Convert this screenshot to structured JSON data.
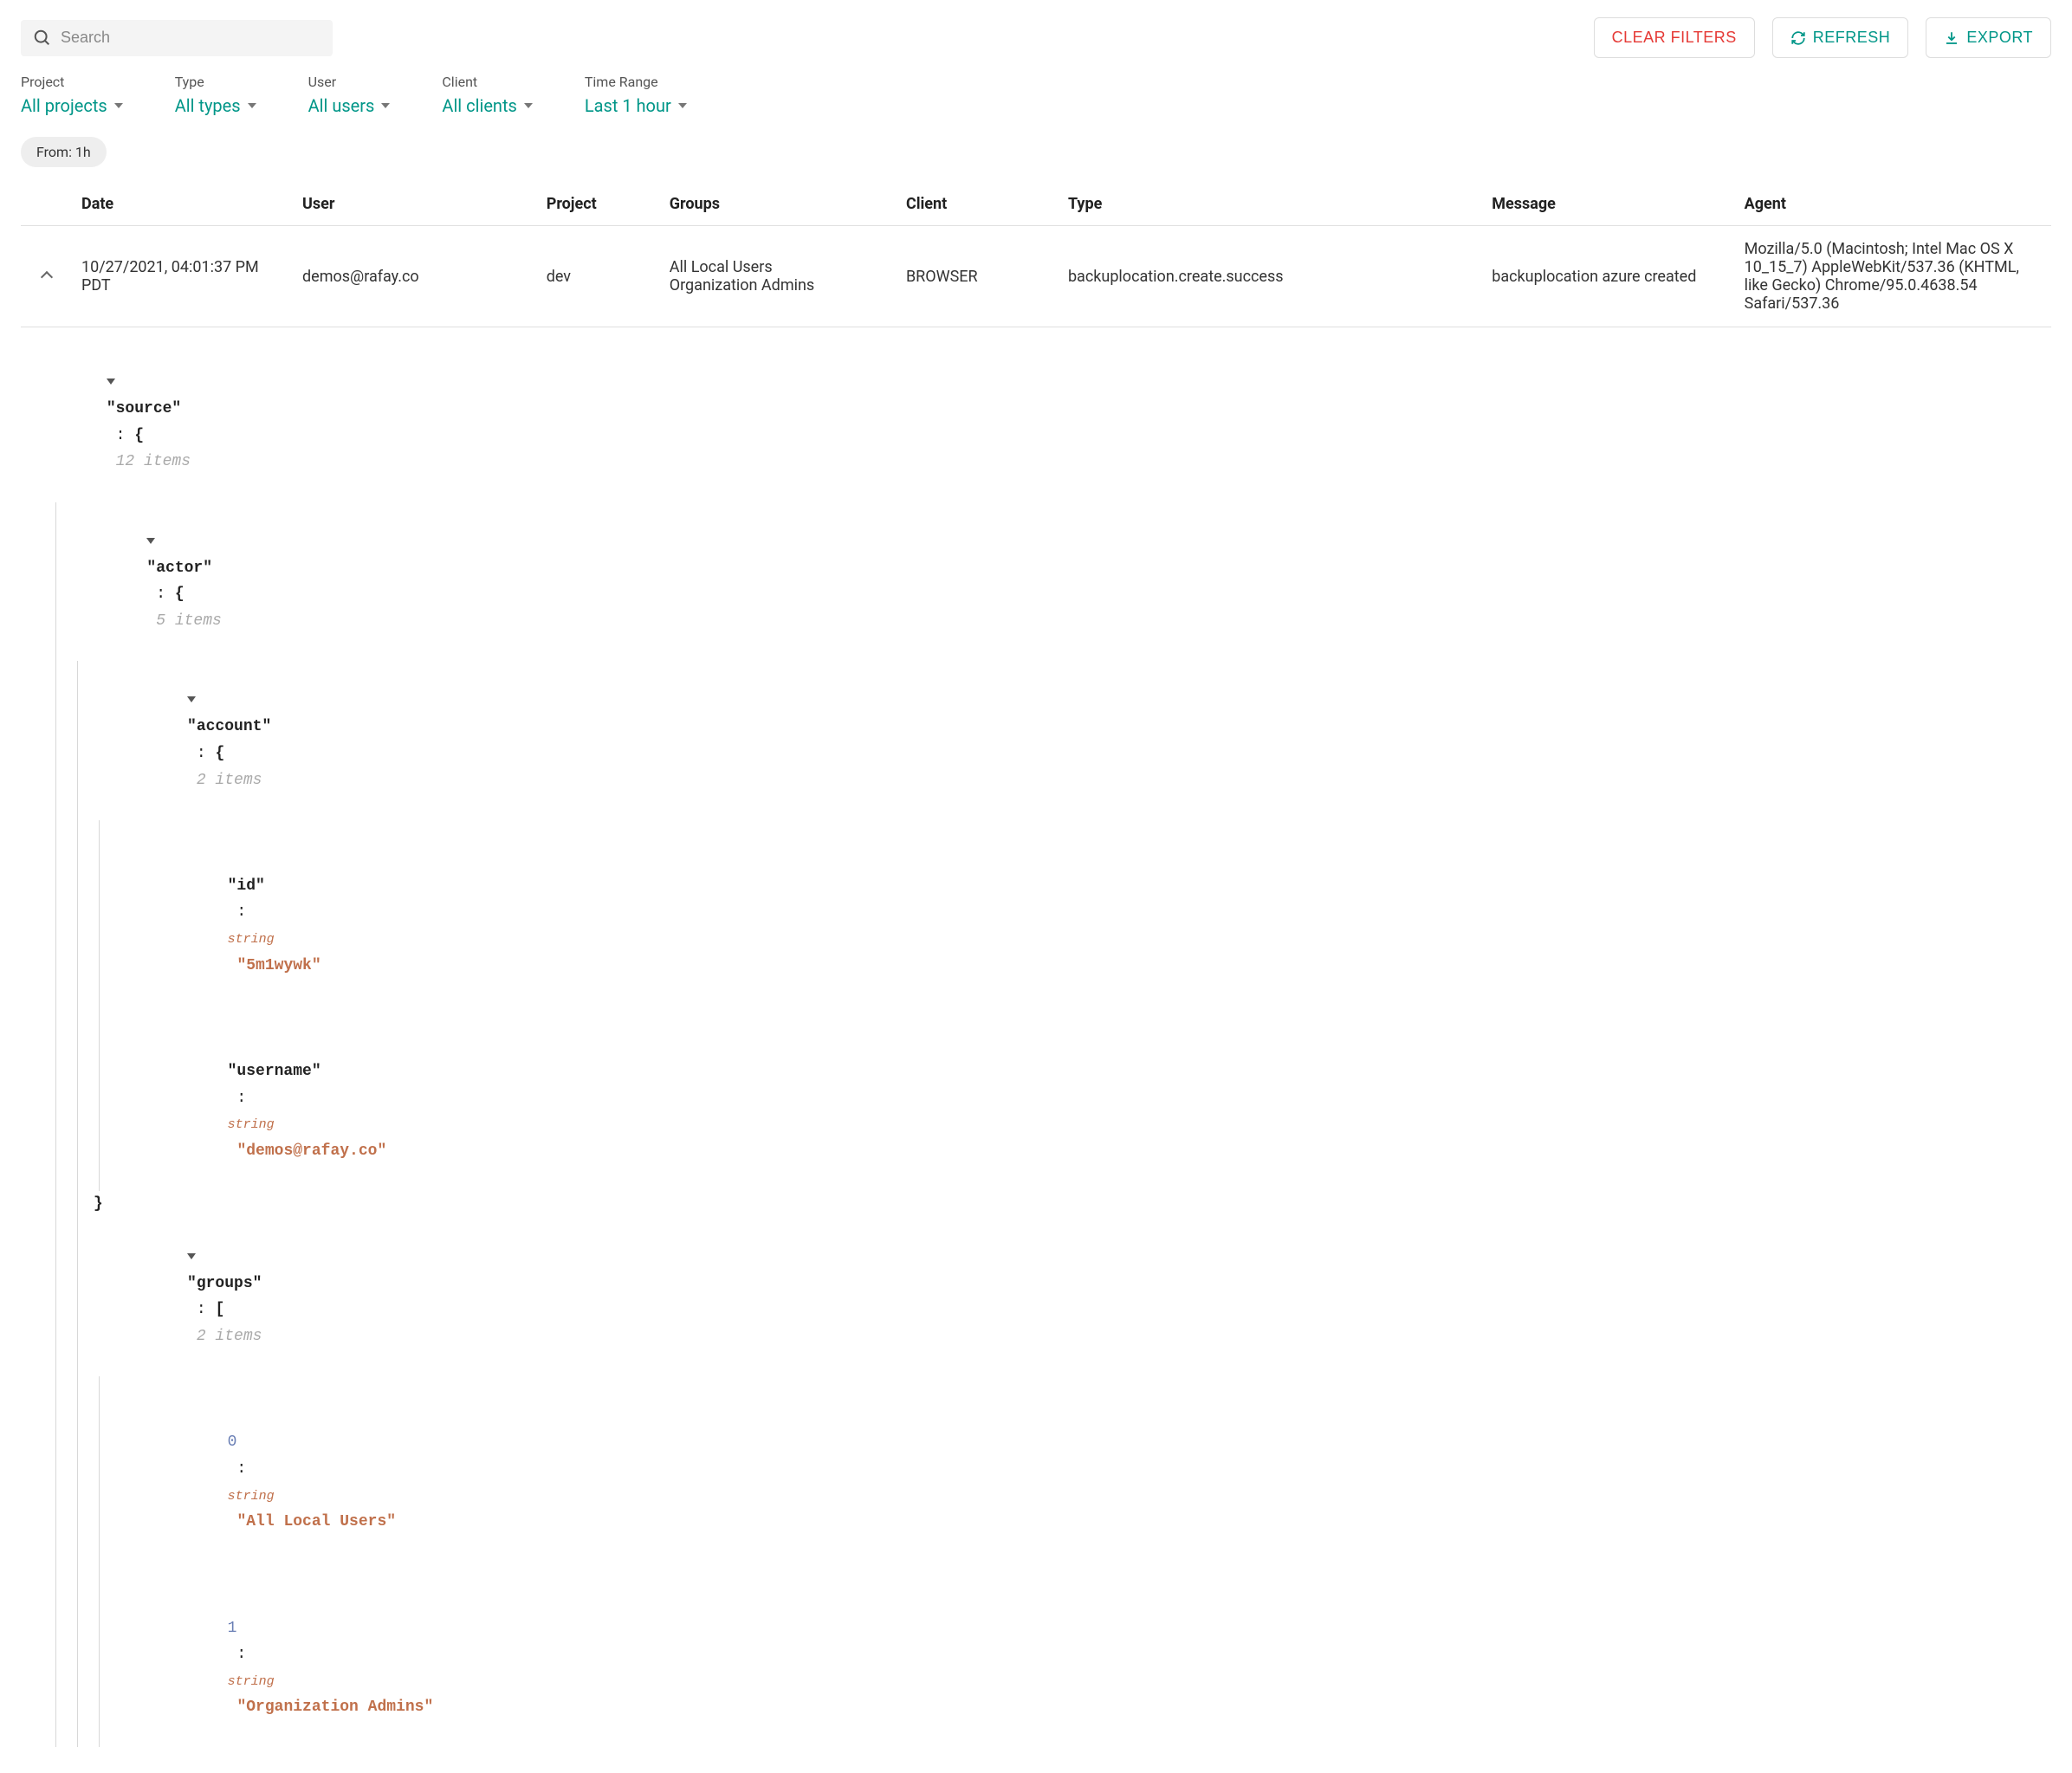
{
  "search": {
    "placeholder": "Search"
  },
  "actions": {
    "clear_filters": "CLEAR FILTERS",
    "refresh": "REFRESH",
    "export": "EXPORT"
  },
  "filters": {
    "project": {
      "label": "Project",
      "value": "All projects"
    },
    "type": {
      "label": "Type",
      "value": "All types"
    },
    "user": {
      "label": "User",
      "value": "All users"
    },
    "client": {
      "label": "Client",
      "value": "All clients"
    },
    "time": {
      "label": "Time Range",
      "value": "Last 1 hour"
    }
  },
  "chip": "From: 1h",
  "columns": {
    "date": "Date",
    "user": "User",
    "project": "Project",
    "groups": "Groups",
    "client": "Client",
    "type": "Type",
    "message": "Message",
    "agent": "Agent"
  },
  "row": {
    "date": "10/27/2021, 04:01:37 PM PDT",
    "user": "demos@rafay.co",
    "project": "dev",
    "groups": "All Local Users\nOrganization Admins",
    "client": "BROWSER",
    "type": "backuplocation.create.success",
    "message": "backuplocation azure created",
    "agent": "Mozilla/5.0 (Macintosh; Intel Mac OS X 10_15_7) AppleWebKit/537.36 (KHTML, like Gecko) Chrome/95.0.4638.54 Safari/537.36"
  },
  "detail": {
    "source_key": "\"source\"",
    "source_items": "12 items",
    "actor_key": "\"actor\"",
    "actor_items": "5 items",
    "account_key": "\"account\"",
    "account_items": "2 items",
    "id_key": "\"id\"",
    "id_type": "string",
    "id_val": "\"5m1wywk\"",
    "username_key": "\"username\"",
    "username_type": "string",
    "username_val": "\"demos@rafay.co\"",
    "close_brace": "}",
    "groups_key": "\"groups\"",
    "groups_open": "[",
    "groups_items": "2 items",
    "g0_idx": "0",
    "g0_type": "string",
    "g0_val": "\"All Local Users\"",
    "g1_idx": "1",
    "g1_type": "string",
    "g1_val": "\"Organization Admins\""
  }
}
